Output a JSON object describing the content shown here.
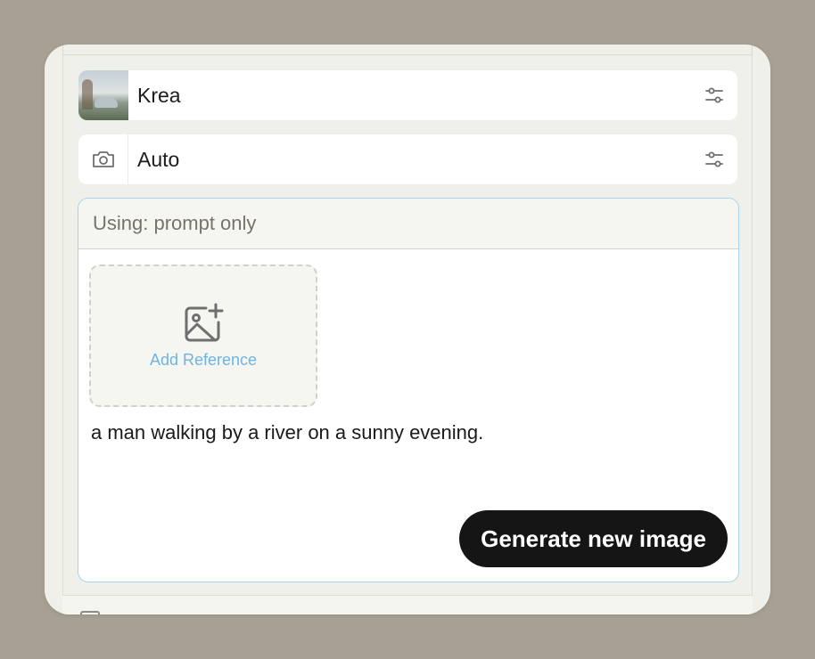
{
  "model": {
    "label": "Krea",
    "thumbnail_icon": "car-photo-thumbnail",
    "settings_icon": "sliders-icon"
  },
  "camera": {
    "label": "Auto",
    "icon": "camera-icon",
    "settings_icon": "sliders-icon"
  },
  "prompt": {
    "mode_label": "Using: prompt only",
    "add_reference_label": "Add Reference",
    "add_reference_icon": "image-plus-icon",
    "text": "a man walking by a river on a sunny evening.",
    "generate_label": "Generate new image"
  },
  "colors": {
    "background": "#a8a193",
    "accent_blue": "#6cb4e6",
    "button_dark": "#151515",
    "focus_border": "#a9d2ec"
  }
}
